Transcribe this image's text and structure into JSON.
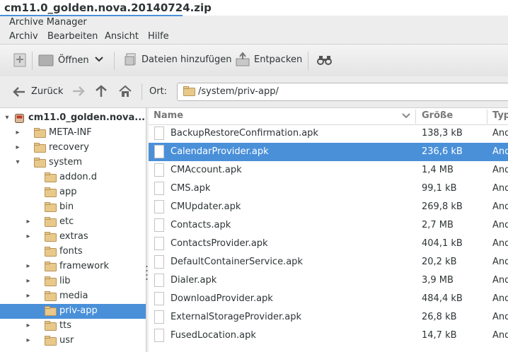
{
  "window": {
    "title": "cm11.0_golden.nova.20140724.zip",
    "app_name": "Archive Manager"
  },
  "menu": [
    "Archiv",
    "Bearbeiten",
    "Ansicht",
    "Hilfe"
  ],
  "toolbar": {
    "open_label": "Öffnen",
    "add_files_label": "Dateien hinzufügen",
    "extract_label": "Entpacken"
  },
  "location": {
    "back_label": "Zurück",
    "location_label": "Ort:",
    "path": "/system/priv-app/"
  },
  "tree": [
    {
      "label": "cm11.0_golden.nova....",
      "level": 0,
      "expanded": true,
      "root": true
    },
    {
      "label": "META-INF",
      "level": 1,
      "expanded": false,
      "has_children": true
    },
    {
      "label": "recovery",
      "level": 1,
      "expanded": false,
      "has_children": true
    },
    {
      "label": "system",
      "level": 1,
      "expanded": true,
      "has_children": true
    },
    {
      "label": "addon.d",
      "level": 2,
      "has_children": false
    },
    {
      "label": "app",
      "level": 2,
      "has_children": false
    },
    {
      "label": "bin",
      "level": 2,
      "has_children": false
    },
    {
      "label": "etc",
      "level": 2,
      "has_children": true
    },
    {
      "label": "extras",
      "level": 2,
      "has_children": true
    },
    {
      "label": "fonts",
      "level": 2,
      "has_children": false
    },
    {
      "label": "framework",
      "level": 2,
      "has_children": true
    },
    {
      "label": "lib",
      "level": 2,
      "has_children": true
    },
    {
      "label": "media",
      "level": 2,
      "has_children": true
    },
    {
      "label": "priv-app",
      "level": 2,
      "has_children": false,
      "selected": true
    },
    {
      "label": "tts",
      "level": 2,
      "has_children": true
    },
    {
      "label": "usr",
      "level": 2,
      "has_children": true
    }
  ],
  "columns": {
    "name": "Name",
    "size": "Größe",
    "type": "Typ"
  },
  "files": [
    {
      "name": "BackupRestoreConfirmation.apk",
      "size": "138,3 kB",
      "type": "And"
    },
    {
      "name": "CalendarProvider.apk",
      "size": "236,6 kB",
      "type": "And",
      "selected": true
    },
    {
      "name": "CMAccount.apk",
      "size": "1,4 MB",
      "type": "And"
    },
    {
      "name": "CMS.apk",
      "size": "99,1 kB",
      "type": "And"
    },
    {
      "name": "CMUpdater.apk",
      "size": "269,8 kB",
      "type": "And"
    },
    {
      "name": "Contacts.apk",
      "size": "2,7 MB",
      "type": "And"
    },
    {
      "name": "ContactsProvider.apk",
      "size": "404,1 kB",
      "type": "And"
    },
    {
      "name": "DefaultContainerService.apk",
      "size": "20,2 kB",
      "type": "And"
    },
    {
      "name": "Dialer.apk",
      "size": "3,9 MB",
      "type": "And"
    },
    {
      "name": "DownloadProvider.apk",
      "size": "484,4 kB",
      "type": "And"
    },
    {
      "name": "ExternalStorageProvider.apk",
      "size": "26,8 kB",
      "type": "And"
    },
    {
      "name": "FusedLocation.apk",
      "size": "14,7 kB",
      "type": "And"
    }
  ],
  "colors": {
    "accent": "#4a90d9",
    "folder": "#e8c98a"
  }
}
